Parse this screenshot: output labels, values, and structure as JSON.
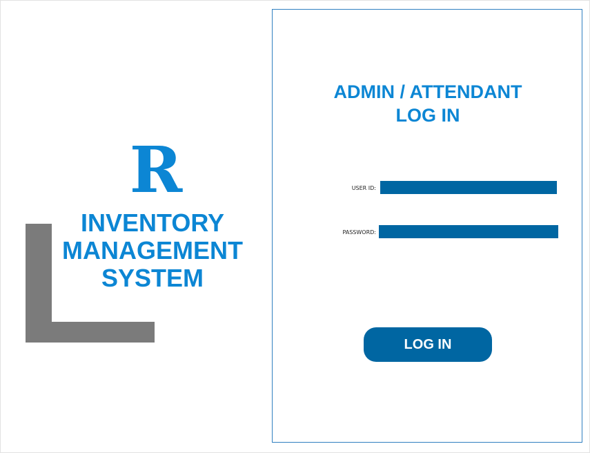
{
  "brand": {
    "logo_letter": "R",
    "title_lines": [
      "INVENTORY",
      "MANAGEMENT",
      "SYSTEM"
    ]
  },
  "login": {
    "title_lines": [
      "ADMIN / ATTENDANT",
      "LOG IN"
    ],
    "user_id_label": "USER ID:",
    "user_id_value": "",
    "password_label": "PASSWORD:",
    "password_value": "",
    "button_label": "LOG IN"
  },
  "colors": {
    "brand_blue": "#0c86d4",
    "field_blue": "#0066a2",
    "bracket_gray": "#7b7b7b",
    "panel_border": "#2f7fc0"
  }
}
